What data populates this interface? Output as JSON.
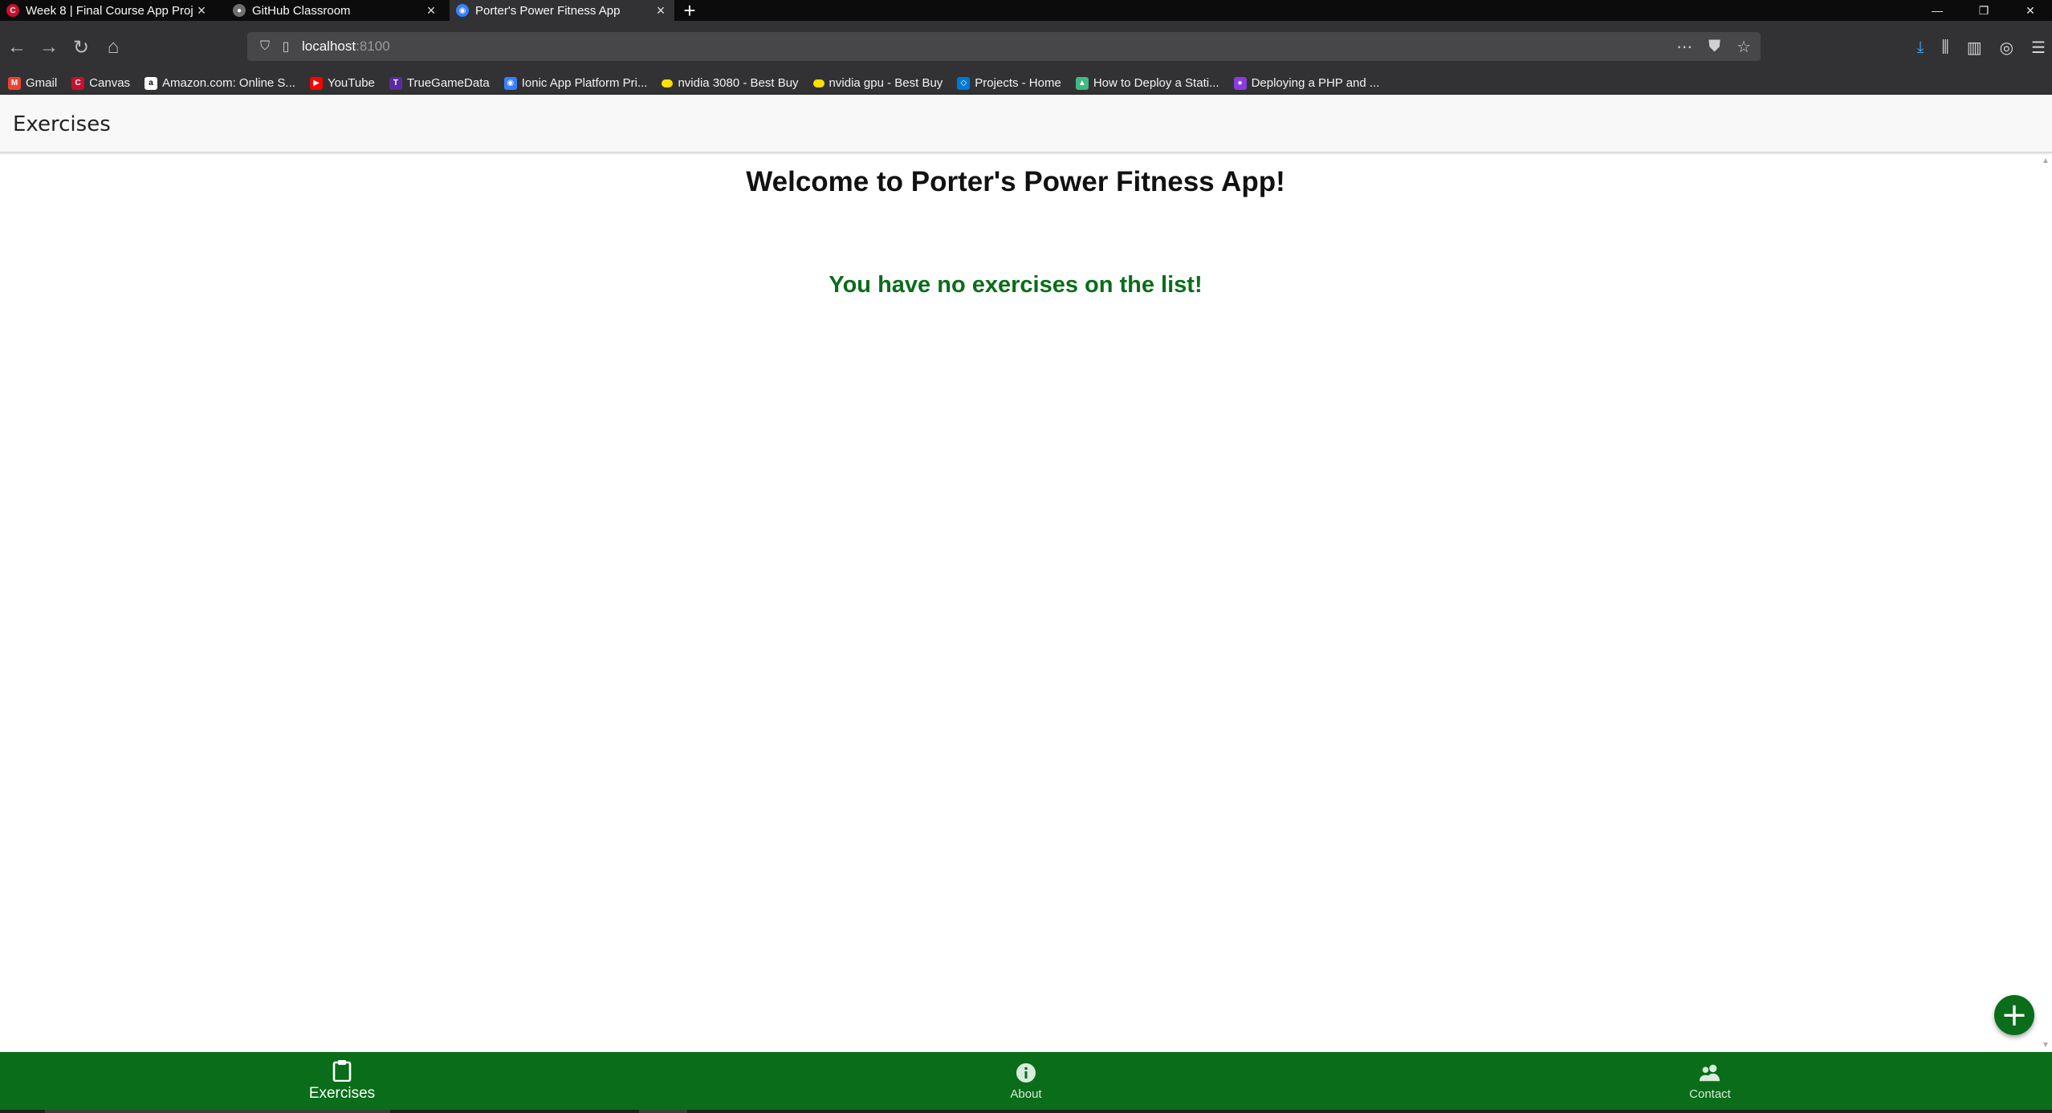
{
  "browser": {
    "tabs": [
      {
        "title": "Week 8 | Final Course App Proj",
        "favicon_color": "#c8102e",
        "active": false
      },
      {
        "title": "GitHub Classroom",
        "favicon_color": "#6e6e6e",
        "active": false
      },
      {
        "title": "Porter's Power Fitness App",
        "favicon_color": "#3880ff",
        "active": true
      }
    ],
    "url_host": "localhost",
    "url_port": ":8100",
    "bookmarks": [
      {
        "label": "Gmail",
        "icon": "gmail-icon",
        "color": "#ea4335",
        "glyph": "M"
      },
      {
        "label": "Canvas",
        "icon": "canvas-icon",
        "color": "#c8102e",
        "glyph": "C"
      },
      {
        "label": "Amazon.com: Online S...",
        "icon": "amazon-icon",
        "color": "#ffffff",
        "glyph": "a"
      },
      {
        "label": "YouTube",
        "icon": "youtube-icon",
        "color": "#ff0000",
        "glyph": "▶"
      },
      {
        "label": "TrueGameData",
        "icon": "truegamedata-icon",
        "color": "#5b2ca0",
        "glyph": "T"
      },
      {
        "label": "Ionic App Platform Pri...",
        "icon": "ionic-icon",
        "color": "#3880ff",
        "glyph": "◉"
      },
      {
        "label": "nvidia 3080 - Best Buy",
        "icon": "bestbuy-icon",
        "color": "#ffe000",
        "glyph": ""
      },
      {
        "label": "nvidia gpu - Best Buy",
        "icon": "bestbuy-icon",
        "color": "#ffe000",
        "glyph": ""
      },
      {
        "label": "Projects - Home",
        "icon": "azure-devops-icon",
        "color": "#0078d4",
        "glyph": "◇"
      },
      {
        "label": "How to Deploy a Stati...",
        "icon": "vue-icon",
        "color": "#41b883",
        "glyph": "▲"
      },
      {
        "label": "Deploying a PHP and ...",
        "icon": "php-deploy-icon",
        "color": "#8a3cdc",
        "glyph": "●"
      }
    ]
  },
  "app": {
    "header_title": "Exercises",
    "welcome_text": "Welcome to Porter's Power Fitness App!",
    "empty_message": "You have no exercises on the list!",
    "fab_label": "+",
    "accent_color": "#0a6d19",
    "tabs": [
      {
        "label": "Exercises",
        "icon": "clipboard-icon",
        "selected": true
      },
      {
        "label": "About",
        "icon": "information-circle-icon",
        "selected": false
      },
      {
        "label": "Contact",
        "icon": "people-icon",
        "selected": false
      }
    ]
  }
}
